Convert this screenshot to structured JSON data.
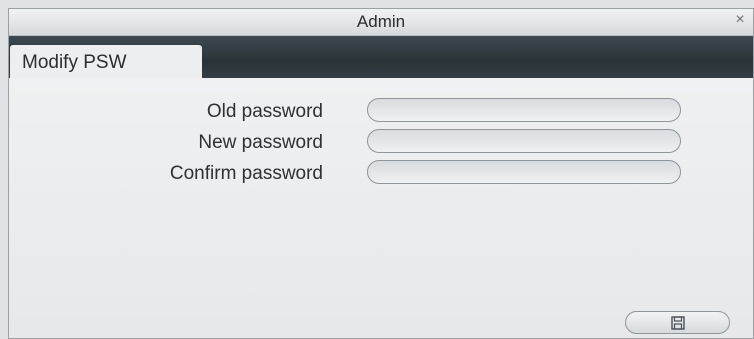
{
  "window": {
    "title": "Admin",
    "close_glyph": "×"
  },
  "tabs": [
    {
      "label": "Modify PSW",
      "active": true
    }
  ],
  "form": {
    "fields": [
      {
        "label": "Old password",
        "value": "",
        "type": "password"
      },
      {
        "label": "New password",
        "value": "",
        "type": "password"
      },
      {
        "label": "Confirm password",
        "value": "",
        "type": "password"
      }
    ]
  },
  "footer": {
    "save_icon": "save-icon"
  }
}
